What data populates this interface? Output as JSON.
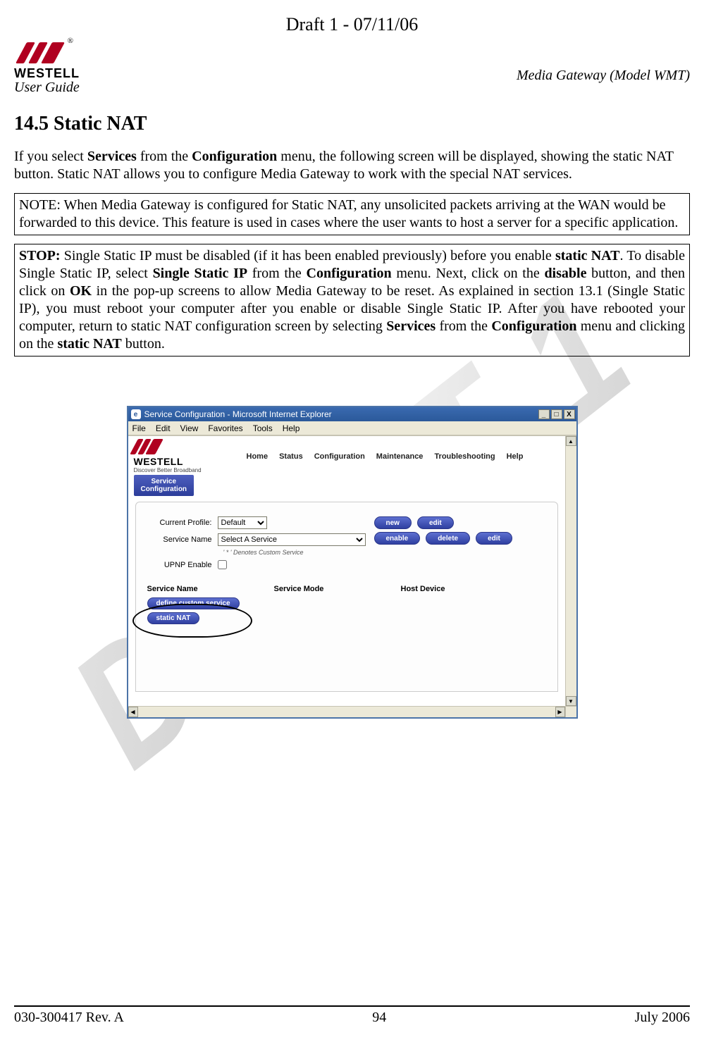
{
  "draft_header": "Draft 1 - 07/11/06",
  "logo": {
    "reg": "®",
    "name": "WESTELL"
  },
  "header": {
    "left": "User Guide",
    "right": "Media Gateway (Model WMT)"
  },
  "section_title": "14.5 Static NAT",
  "intro_pre": "If you select ",
  "intro_b1": "Services",
  "intro_mid1": " from the ",
  "intro_b2": "Configuration",
  "intro_post": " menu, the following screen will be displayed, showing the static NAT button. Static NAT allows you to configure Media Gateway to work with the special NAT services.",
  "note_text": "NOTE: When Media Gateway is configured for Static NAT, any unsolicited packets arriving at the WAN would be forwarded to this device. This feature is used in cases where the user wants to host a server for a specific application.",
  "stop": {
    "lead": "STOP: ",
    "t1": "Single Static IP must be disabled (if it has been enabled previously) before you enable ",
    "b1": "static NAT",
    "t2": ". To disable Single Static IP, select ",
    "b2": "Single Static IP",
    "t3": " from the ",
    "b3": "Configuration",
    "t4": " menu. Next, click on the ",
    "b4": "disable",
    "t5": " button, and then click on ",
    "b5": "OK",
    "t6": " in the pop-up screens to allow Media Gateway to be reset. As explained in section 13.1 (Single Static IP), you must reboot your computer after you enable or disable Single Static IP. After you have rebooted your computer, return to static NAT configuration screen by selecting ",
    "b6": "Services",
    "t7": " from the ",
    "b7": "Configuration",
    "t8": " menu and clicking on the ",
    "b8": "static NAT",
    "t9": " button."
  },
  "browser": {
    "title": "Service Configuration - Microsoft Internet Explorer",
    "ie_icon": "e",
    "menus": {
      "file": "File",
      "edit": "Edit",
      "view": "View",
      "favorites": "Favorites",
      "tools": "Tools",
      "help": "Help"
    },
    "winbtn": {
      "min": "_",
      "max": "□",
      "close": "X"
    },
    "scroll": {
      "up": "▲",
      "down": "▼",
      "left": "◀",
      "right": "▶"
    }
  },
  "app": {
    "brand": "WESTELL",
    "tagline": "Discover Better Broadband",
    "nav": [
      "Home",
      "Status",
      "Configuration",
      "Maintenance",
      "Troubleshooting",
      "Help"
    ],
    "tab": "Service\nConfiguration",
    "labels": {
      "profile": "Current Profile:",
      "service": "Service Name",
      "upnp": "UPNP Enable"
    },
    "profile_value": "Default",
    "service_value": "Select A Service",
    "footnote": "' * ' Denotes Custom Service",
    "buttons": {
      "new": "new",
      "edit": "edit",
      "enable": "enable",
      "delete": "delete",
      "edit2": "edit"
    },
    "cols": {
      "c1": "Service Name",
      "c2": "Service Mode",
      "c3": "Host Device"
    },
    "define_custom": "define custom service",
    "static_nat": "static NAT"
  },
  "footer": {
    "left": "030-300417 Rev. A",
    "center": "94",
    "right": "July 2006"
  },
  "watermark": "DRAFT 1"
}
